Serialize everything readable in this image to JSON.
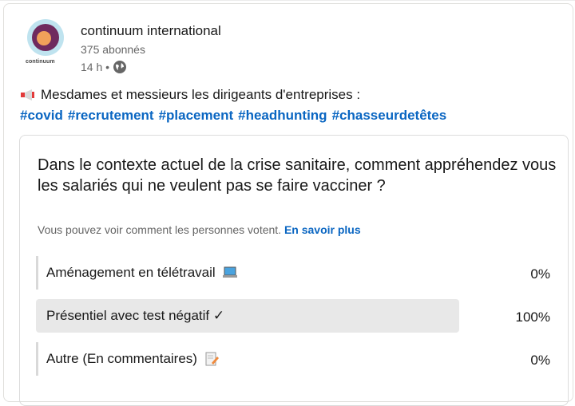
{
  "author": {
    "name": "continuum international",
    "followers": "375 abonnés",
    "time": "14 h •",
    "logo_text": "continuum"
  },
  "post": {
    "text": "Mesdames et messieurs les dirigeants d'entreprises :",
    "hashtags": [
      "#covid",
      "#recrutement",
      "#placement",
      "#headhunting",
      "#chasseurdetêtes"
    ]
  },
  "poll": {
    "question": "Dans le contexte actuel de la crise sanitaire, comment appréhendez vous les salariés qui ne veulent pas se faire vacciner ?",
    "info": "Vous pouvez voir comment les personnes votent.",
    "learn_more": "En savoir plus",
    "options": [
      {
        "label": "Aménagement en télétravail",
        "percent": "0%",
        "icon": "laptop-icon"
      },
      {
        "label": "Présentiel avec test négatif ✓",
        "percent": "100%",
        "icon": ""
      },
      {
        "label": "Autre (En commentaires)",
        "percent": "0%",
        "icon": "memo-icon"
      }
    ]
  },
  "colors": {
    "link": "#0a66c2",
    "selected_bg": "#e8e8e8"
  }
}
